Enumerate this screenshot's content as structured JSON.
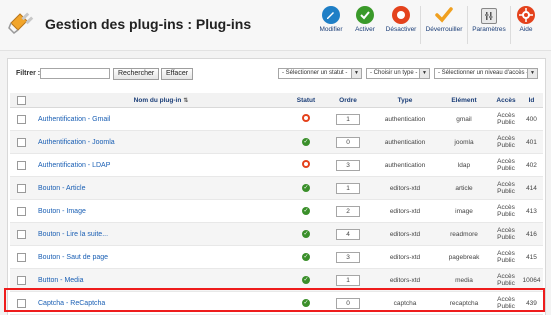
{
  "header": {
    "title": "Gestion des plug-ins : Plug-ins"
  },
  "toolbar": {
    "buttons": [
      {
        "label": "Modifier",
        "icon": "edit-icon",
        "color": "#1f7fc6"
      },
      {
        "label": "Activer",
        "icon": "check-icon",
        "color": "#3a9a2a"
      },
      {
        "label": "Désactiver",
        "icon": "disable-icon",
        "color": "#e4421c"
      },
      {
        "label": "Déverrouiller",
        "icon": "unlock-checkmark-icon",
        "color": "#f0a020"
      },
      {
        "label": "Paramètres",
        "icon": "settings-icon",
        "color": "#666666"
      },
      {
        "label": "Aide",
        "icon": "help-icon",
        "color": "#e4421c"
      }
    ]
  },
  "filter": {
    "label": "Filtrer :",
    "value": "",
    "search_button": "Rechercher",
    "clear_button": "Effacer",
    "status_select": "- Sélectionner un statut -",
    "type_select": "- Choisir un type -",
    "access_select": "- Sélectionner un niveau d'accès -"
  },
  "table": {
    "headers": {
      "name": "Nom du plug-in",
      "status": "Statut",
      "order": "Ordre",
      "type": "Type",
      "element": "Elément",
      "access": "Accès",
      "id": "Id"
    },
    "rows": [
      {
        "name": "Authentification - Gmail",
        "status": "disabled",
        "order": "1",
        "type": "authentication",
        "element": "gmail",
        "access": "Accès Public",
        "id": "400"
      },
      {
        "name": "Authentification - Joomla",
        "status": "enabled",
        "order": "0",
        "type": "authentication",
        "element": "joomla",
        "access": "Accès Public",
        "id": "401"
      },
      {
        "name": "Authentification - LDAP",
        "status": "disabled",
        "order": "3",
        "type": "authentication",
        "element": "ldap",
        "access": "Accès Public",
        "id": "402"
      },
      {
        "name": "Bouton - Article",
        "status": "enabled",
        "order": "1",
        "type": "editors-xtd",
        "element": "article",
        "access": "Accès Public",
        "id": "414"
      },
      {
        "name": "Bouton - Image",
        "status": "enabled",
        "order": "2",
        "type": "editors-xtd",
        "element": "image",
        "access": "Accès Public",
        "id": "413"
      },
      {
        "name": "Bouton - Lire la suite...",
        "status": "enabled",
        "order": "4",
        "type": "editors-xtd",
        "element": "readmore",
        "access": "Accès Public",
        "id": "416"
      },
      {
        "name": "Bouton - Saut de page",
        "status": "enabled",
        "order": "3",
        "type": "editors-xtd",
        "element": "pagebreak",
        "access": "Accès Public",
        "id": "415"
      },
      {
        "name": "Button - Media",
        "status": "enabled",
        "order": "1",
        "type": "editors-xtd",
        "element": "media",
        "access": "Accès Public",
        "id": "10064"
      },
      {
        "name": "Captcha - ReCaptcha",
        "status": "enabled",
        "order": "0",
        "type": "captcha",
        "element": "recaptcha",
        "access": "Accès Public",
        "id": "439"
      }
    ]
  },
  "colors": {
    "link": "#1a5fb4",
    "header_text": "#1a3d77",
    "highlight": "#ee1c1c",
    "enabled": "#3a8f2a",
    "disabled": "#e4421c"
  }
}
